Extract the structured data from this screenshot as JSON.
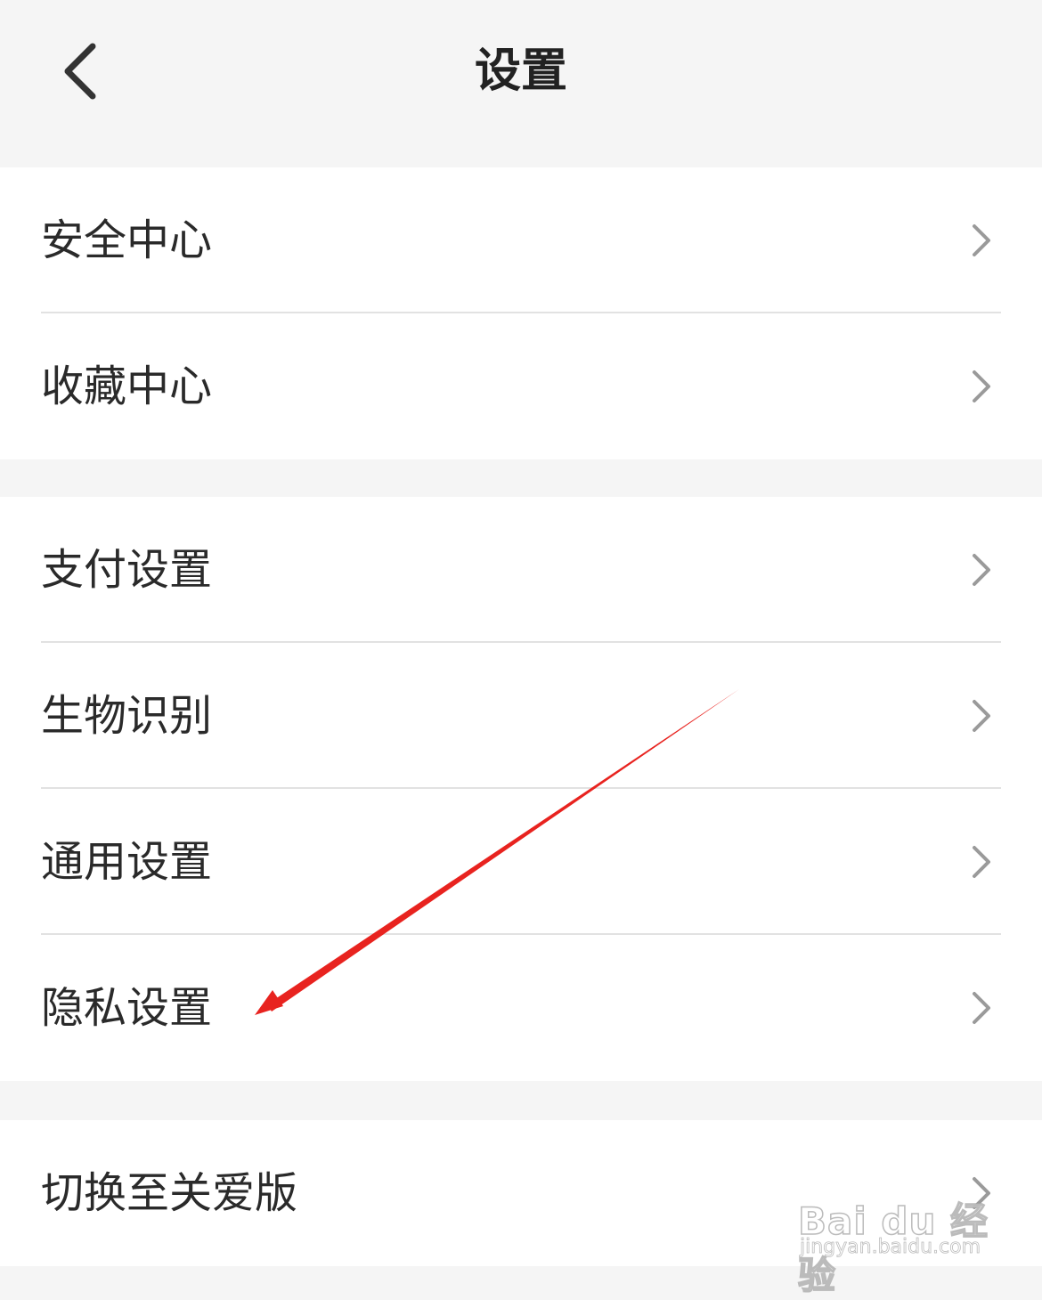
{
  "header": {
    "title": "设置",
    "back_icon": "chevron-left-icon"
  },
  "groups": [
    {
      "items": [
        {
          "label": "安全中心"
        },
        {
          "label": "收藏中心"
        }
      ]
    },
    {
      "items": [
        {
          "label": "支付设置"
        },
        {
          "label": "生物识别"
        },
        {
          "label": "通用设置"
        },
        {
          "label": "隐私设置"
        }
      ]
    },
    {
      "items": [
        {
          "label": "切换至关爱版"
        }
      ]
    }
  ],
  "annotation": {
    "type": "arrow",
    "color": "#e8231f",
    "points_to": "隐私设置"
  },
  "watermark": {
    "brand": "Bai du 经验",
    "url": "jingyan.baidu.com"
  },
  "colors": {
    "background": "#f5f5f5",
    "card": "#ffffff",
    "divider": "#e2e2e2",
    "text": "#2a2a2a",
    "chevron": "#9a9a9a"
  }
}
